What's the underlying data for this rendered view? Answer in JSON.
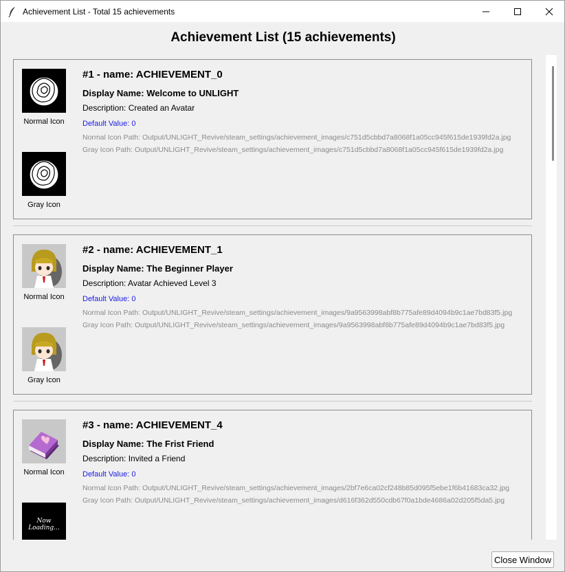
{
  "window": {
    "title": "Achievement List - Total 15 achievements"
  },
  "heading": "Achievement List (15 achievements)",
  "labels": {
    "normal_icon": "Normal Icon",
    "gray_icon": "Gray Icon"
  },
  "achievements": [
    {
      "title": "#1 - name: ACHIEVEMENT_0",
      "display_name": "Display Name: Welcome to UNLIGHT",
      "description": "Description: Created an Avatar",
      "default_value": "Default Value: 0",
      "normal_icon_path": "Normal Icon Path: Output/UNLIGHT_Revive/steam_settings/achievement_images/c751d5cbbd7a8068f1a05cc945f615de1939fd2a.jpg",
      "gray_icon_path": "Gray Icon Path: Output/UNLIGHT_Revive/steam_settings/achievement_images/c751d5cbbd7a8068f1a05cc945f615de1939fd2a.jpg",
      "normal_icon": "rose-icon",
      "gray_icon": "rose-icon"
    },
    {
      "title": "#2 - name: ACHIEVEMENT_1",
      "display_name": "Display Name: The Beginner Player",
      "description": "Description: Avatar Achieved Level 3",
      "default_value": "Default Value: 0",
      "normal_icon_path": "Normal Icon Path: Output/UNLIGHT_Revive/steam_settings/achievement_images/9a9563998abf8b775afe89d4094b9c1ae7bd83f5.jpg",
      "gray_icon_path": "Gray Icon Path: Output/UNLIGHT_Revive/steam_settings/achievement_images/9a9563998abf8b775afe89d4094b9c1ae7bd83f5.jpg",
      "normal_icon": "chibi-girl-icon",
      "gray_icon": "chibi-girl-icon"
    },
    {
      "title": "#3 - name: ACHIEVEMENT_4",
      "display_name": "Display Name: The Frist Friend",
      "description": "Description: Invited a Friend",
      "default_value": "Default Value: 0",
      "normal_icon_path": "Normal Icon Path: Output/UNLIGHT_Revive/steam_settings/achievement_images/2bf7e6ca02cf248b85d095f5ebe1f6b41683ca32.jpg",
      "gray_icon_path": "Gray Icon Path: Output/UNLIGHT_Revive/steam_settings/achievement_images/d616f362d550cdb67f0a1bde4686a02d205f5da5.jpg",
      "normal_icon": "heart-book-icon",
      "gray_icon": "now-loading-icon",
      "gray_icon_text": "Now Loading..."
    }
  ],
  "close_button": "Close Window"
}
